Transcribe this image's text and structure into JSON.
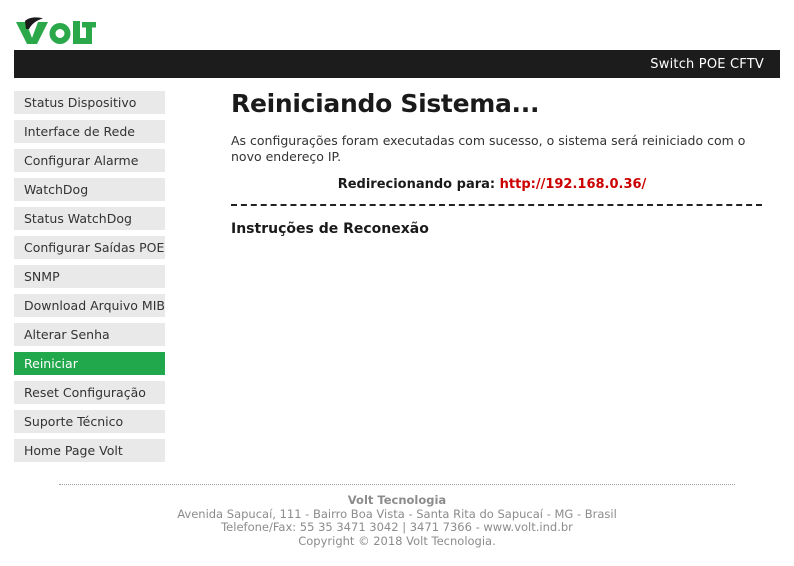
{
  "brand": {
    "logo_text": "VOLT",
    "logo_color": "#2aa84a",
    "logo_accent_color": "#1a1a1a"
  },
  "titlebar": {
    "product_name": "Switch POE CFTV",
    "background": "#1c1c1c",
    "text_color": "#ffffff"
  },
  "sidebar": {
    "active_color": "#22a84c",
    "item_background": "#e9e9e9",
    "items": [
      {
        "label": "Status Dispositivo",
        "active": false
      },
      {
        "label": "Interface de Rede",
        "active": false
      },
      {
        "label": "Configurar Alarme",
        "active": false
      },
      {
        "label": "WatchDog",
        "active": false
      },
      {
        "label": "Status WatchDog",
        "active": false
      },
      {
        "label": "Configurar Saídas POE",
        "active": false
      },
      {
        "label": "SNMP",
        "active": false
      },
      {
        "label": "Download Arquivo MIB",
        "active": false
      },
      {
        "label": "Alterar Senha",
        "active": false
      },
      {
        "label": "Reiniciar",
        "active": true
      },
      {
        "label": "Reset Configuração",
        "active": false
      },
      {
        "label": "Suporte Técnico",
        "active": false
      },
      {
        "label": "Home Page Volt",
        "active": false
      }
    ]
  },
  "main": {
    "title": "Reiniciando Sistema...",
    "intro": "As configurações foram executadas com sucesso, o sistema será reiniciado com o novo endereço IP.",
    "redirect_label": "Redirecionando para:",
    "redirect_url": "http://192.168.0.36/",
    "redirect_url_color": "#cc0000",
    "section_title": "Instruções de Reconexão"
  },
  "footer": {
    "company": "Volt Tecnologia",
    "address": "Avenida Sapucaí, 111 - Bairro Boa Vista - Santa Rita do Sapucaí - MG - Brasil",
    "contact": "Telefone/Fax: 55 35 3471 3042 | 3471 7366 - www.volt.ind.br",
    "copyright": "Copyright © 2018 Volt Tecnologia."
  }
}
